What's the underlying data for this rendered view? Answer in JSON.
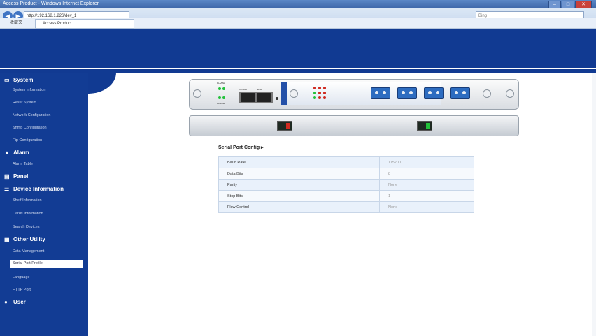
{
  "browser": {
    "window_title": "Access Product - Windows Internet Explorer",
    "url": "http://192.168.1.226/dev_1",
    "search_placeholder": "Bing",
    "favorites_label": "收藏夹",
    "tab_label": "Access Product",
    "window_buttons": [
      "–",
      "□",
      "✕"
    ]
  },
  "sidebar": {
    "sections": [
      {
        "label": "System",
        "icon": "monitor-icon",
        "items": [
          "System Information",
          "Reset System",
          "Network Configuration",
          "Snmp Configuration",
          "Ftp Configuration"
        ]
      },
      {
        "label": "Alarm",
        "icon": "warning-icon",
        "items": [
          "Alarm Table"
        ]
      },
      {
        "label": "Panel",
        "icon": "panel-icon",
        "items": []
      },
      {
        "label": "Device Information",
        "icon": "device-icon",
        "items": [
          "Shelf Information",
          "Cards Information",
          "Search Devices"
        ]
      },
      {
        "label": "Other Utility",
        "icon": "utility-icon",
        "items": [
          "Data Management",
          "Serial Port Profile",
          "Language",
          "HTTP Port"
        ]
      },
      {
        "label": "User",
        "icon": "user-icon",
        "items": []
      }
    ],
    "active_item": "Serial Port Profile"
  },
  "device_panel": {
    "labels": [
      "PLA/HW",
      "Console",
      "ETH",
      "PLA/HW"
    ]
  },
  "serial_config": {
    "title": "Serial Port Config ▸",
    "rows": [
      {
        "label": "Baud Rate",
        "value": "115200"
      },
      {
        "label": "Data Bits",
        "value": "8"
      },
      {
        "label": "Parity",
        "value": "None"
      },
      {
        "label": "Stop Bits",
        "value": "1"
      },
      {
        "label": "Flow Control",
        "value": "None"
      }
    ]
  },
  "colors": {
    "header_blue": "#113a92",
    "sidebar_blue": "#123c94",
    "table_row": "#e9f1fb",
    "fiber_blue": "#2d6cc0"
  }
}
